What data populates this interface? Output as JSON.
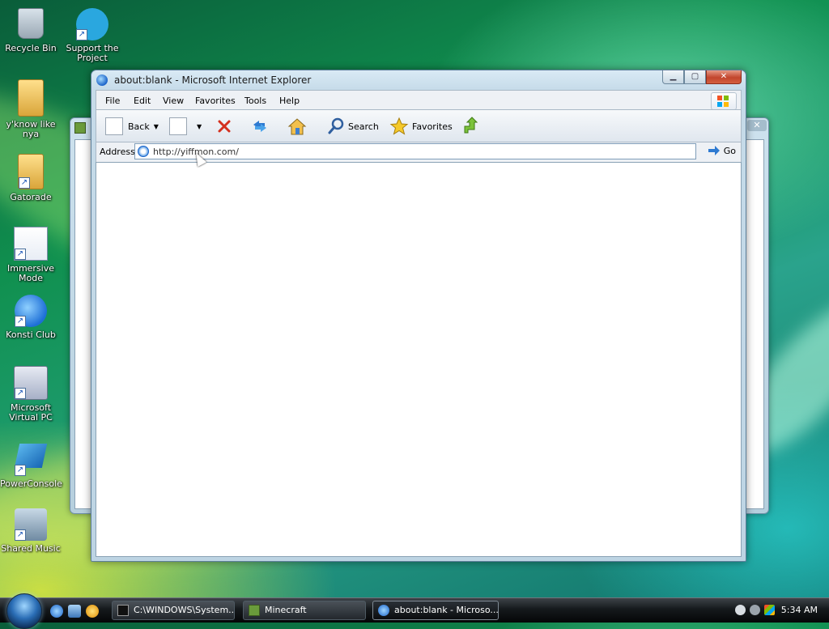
{
  "desktop": {
    "icons": [
      {
        "label": "Recycle Bin",
        "icon": "recycle-bin-icon"
      },
      {
        "label": "Support the Project",
        "icon": "support-heart-icon"
      },
      {
        "label": "y'know like nya",
        "icon": "folder-icon"
      },
      {
        "label": "Gatorade",
        "icon": "folder-icon"
      },
      {
        "label": "Immersive Mode",
        "icon": "gear-window-icon"
      },
      {
        "label": "Konsti Club",
        "icon": "internet-explorer-icon"
      },
      {
        "label": "Microsoft Virtual PC",
        "icon": "virtual-pc-icon"
      },
      {
        "label": "PowerConsole",
        "icon": "powershell-icon"
      },
      {
        "label": "Shared Music",
        "icon": "music-folder-icon"
      }
    ]
  },
  "ie": {
    "title": "about:blank - Microsoft Internet Explorer",
    "menu": [
      "File",
      "Edit",
      "View",
      "Favorites",
      "Tools",
      "Help"
    ],
    "toolbar": {
      "back": "Back",
      "search": "Search",
      "favorites": "Favorites"
    },
    "address": {
      "label": "Address",
      "value": "http://yiffmon.com/",
      "go": "Go"
    }
  },
  "taskbar": {
    "tasks": [
      {
        "label": "C:\\WINDOWS\\System...",
        "icon": "cmd-icon"
      },
      {
        "label": "Minecraft",
        "icon": "minecraft-icon"
      },
      {
        "label": "about:blank - Microso...",
        "icon": "internet-explorer-icon"
      }
    ],
    "clock": "5:34 AM"
  },
  "colors": {
    "close_button": "#c2452d",
    "taskbar": "#15191c",
    "link_blue": "#1a63c9"
  }
}
